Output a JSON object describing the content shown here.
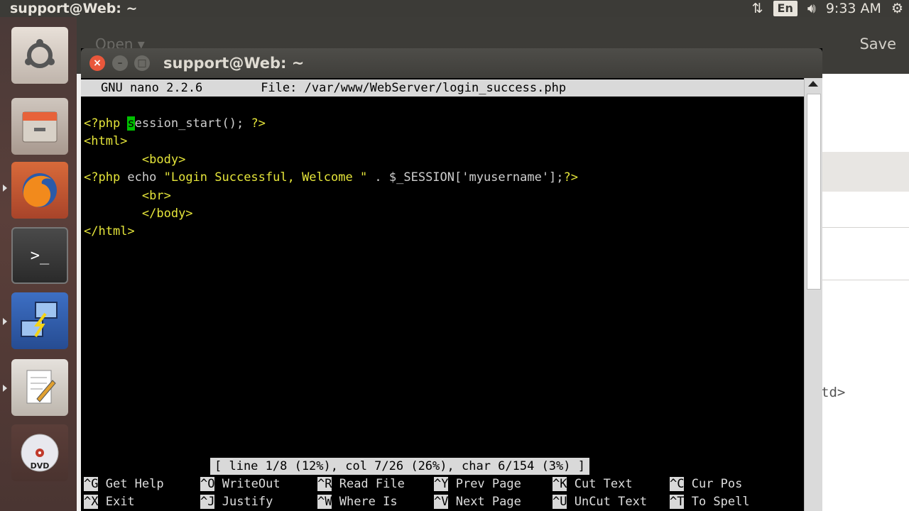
{
  "top_panel": {
    "title": "support@Web: ~",
    "lang": "En",
    "time": "9:33 AM"
  },
  "background_window": {
    "open_label": "Open",
    "save_label": "Save",
    "partial_text": "td>"
  },
  "terminal": {
    "title": "support@Web: ~",
    "nano_header": {
      "version": "GNU nano 2.2.6",
      "file": "File: /var/www/WebServer/login_success.php"
    },
    "code_lines": [
      {
        "parts": [
          [
            "tag",
            "<?php "
          ],
          [
            "cur",
            "s"
          ],
          [
            "plain",
            "ession_start(); "
          ],
          [
            "tag",
            "?>"
          ]
        ]
      },
      {
        "parts": [
          [
            "tag",
            "<html>"
          ]
        ]
      },
      {
        "parts": [
          [
            "plain",
            "        "
          ],
          [
            "tag",
            "<body>"
          ]
        ]
      },
      {
        "parts": [
          [
            "tag",
            "<?php "
          ],
          [
            "plain",
            "echo "
          ],
          [
            "str",
            "\"Login Successful, Welcome \""
          ],
          [
            "plain",
            " . $_SESSION['myusername'];"
          ],
          [
            "tag",
            "?>"
          ]
        ]
      },
      {
        "parts": [
          [
            "plain",
            "        "
          ],
          [
            "tag",
            "<br>"
          ]
        ]
      },
      {
        "parts": [
          [
            "plain",
            "        "
          ],
          [
            "tag",
            "</body>"
          ]
        ]
      },
      {
        "parts": [
          [
            "tag",
            "</html>"
          ]
        ]
      }
    ],
    "status": "[ line 1/8 (12%), col 7/26 (26%), char 6/154 (3%) ]",
    "shortcuts": [
      {
        "key": "^G",
        "label": "Get Help"
      },
      {
        "key": "^O",
        "label": "WriteOut"
      },
      {
        "key": "^R",
        "label": "Read File"
      },
      {
        "key": "^Y",
        "label": "Prev Page"
      },
      {
        "key": "^K",
        "label": "Cut Text"
      },
      {
        "key": "^C",
        "label": "Cur Pos"
      },
      {
        "key": "^X",
        "label": "Exit"
      },
      {
        "key": "^J",
        "label": "Justify"
      },
      {
        "key": "^W",
        "label": "Where Is"
      },
      {
        "key": "^V",
        "label": "Next Page"
      },
      {
        "key": "^U",
        "label": "UnCut Text"
      },
      {
        "key": "^T",
        "label": "To Spell"
      }
    ]
  },
  "launcher": {
    "items": [
      "ubuntu-dash-icon",
      "files-icon",
      "firefox-icon",
      "terminal-icon",
      "remote-desktop-icon",
      "text-editor-icon",
      "dvd-icon"
    ]
  }
}
